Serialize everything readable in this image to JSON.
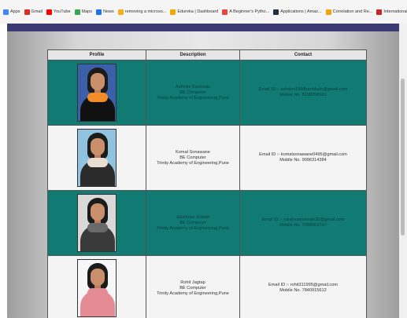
{
  "bookmarks": [
    {
      "label": "Apps",
      "icon": "apps-grid-icon",
      "color": "#4285f4"
    },
    {
      "label": "Gmail",
      "icon": "gmail-icon",
      "color": "#d93025"
    },
    {
      "label": "YouTube",
      "icon": "youtube-icon",
      "color": "#ff0000"
    },
    {
      "label": "Maps",
      "icon": "maps-icon",
      "color": "#34a853"
    },
    {
      "label": "News",
      "icon": "news-icon",
      "color": "#1a73e8"
    },
    {
      "label": "removing a microso...",
      "icon": "microsoft-icon",
      "color": "#f3b01c"
    },
    {
      "label": "Edureka | Dashboard",
      "icon": "edureka-icon",
      "color": "#f2a900"
    },
    {
      "label": "A Beginner's Pytho...",
      "icon": "python-icon",
      "color": "#e8453c"
    },
    {
      "label": "Applications | Amaz...",
      "icon": "amazon-icon",
      "color": "#232f3e"
    },
    {
      "label": "Correlation and Re...",
      "icon": "bookmark-icon",
      "color": "#f0a30a"
    },
    {
      "label": "International Journ...",
      "icon": "journal-icon",
      "color": "#c62828"
    }
  ],
  "more_label": "»",
  "colors": {
    "header_bar": "#3b3a72",
    "teal_row": "#107a73",
    "white_row": "#f4f4f4"
  },
  "table": {
    "headers": {
      "profile": "Profile",
      "description": "Description",
      "contact": "Contact"
    },
    "rows": [
      {
        "style": "teal",
        "name": "Ashwini Bachhale",
        "degree": "BE Computer",
        "college": "Trinity Academy of Engineering,Pune",
        "email": "Email ID :- ashwini1998bachhale@gmail.com",
        "mobile": "Mobile No. 8208958561",
        "photo": {
          "bg": "#3b5fa8",
          "body": "#111111",
          "scarf": "#f28c28"
        }
      },
      {
        "style": "white",
        "name": "Komal Sonawane",
        "degree": "BE Computer",
        "college": "Trinity Academy of Engineering,Pune",
        "email": "Email ID :- komalsonawane0495@gmail.com",
        "mobile": "Mobile No. 9096314384",
        "photo": {
          "bg": "#8fc3df",
          "body": "#2b2b2b",
          "scarf": "#e8ddd0"
        }
      },
      {
        "style": "teal",
        "name": "Vaishnavi Shinde",
        "degree": "BE Computer",
        "college": "Trinity Academy of Engineering,Pune",
        "email": "Email ID :- vaishnavishinde30@gmail.com",
        "mobile": "Mobile No. 7030063747",
        "photo": {
          "bg": "#d9d9d9",
          "body": "#3a3a3a",
          "scarf": "#6a6a6a"
        }
      },
      {
        "style": "white",
        "name": "Rohit Jagtap",
        "degree": "BE Computer",
        "college": "Trinity Academy of Engineering,Pune",
        "email": "Email ID :- rohit311995@gmail.com",
        "mobile": "Mobile No. 7840915612",
        "photo": {
          "bg": "#f7f7f7",
          "body": "#e58b95",
          "scarf": "#e58b95"
        }
      }
    ]
  }
}
